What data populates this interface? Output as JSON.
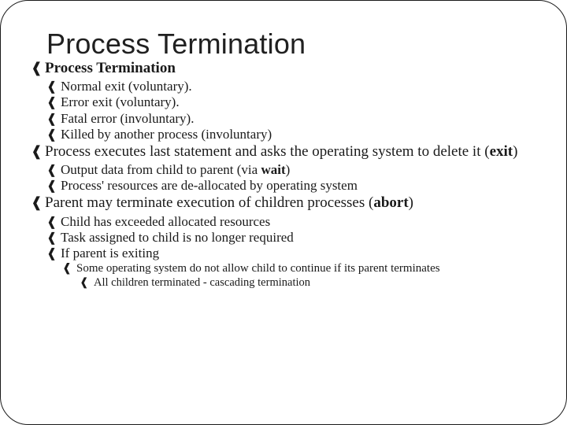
{
  "title": "Process Termination",
  "bullet_glyph": "❰",
  "sections": [
    {
      "head": "Process Termination",
      "sub": [
        "Normal exit (voluntary).",
        "Error exit (voluntary).",
        "Fatal error (involuntary).",
        "Killed by another process (involuntary)"
      ]
    },
    {
      "head_parts": [
        "Process executes last statement and asks the operating system to delete it (",
        "exit",
        ")"
      ],
      "sub": [
        {
          "parts": [
            "Output data from child to parent (via ",
            "wait",
            ")"
          ]
        },
        "Process' resources are de-allocated by operating system"
      ]
    },
    {
      "head_parts": [
        "Parent may terminate execution of children processes (",
        "abort",
        ")"
      ],
      "sub": [
        "Child has exceeded allocated resources",
        "Task assigned to child is no longer required",
        "If parent is exiting"
      ],
      "subsub": [
        "Some operating system do not allow child to continue if its parent terminates"
      ],
      "subsubsub": [
        "All children terminated - cascading termination"
      ]
    }
  ]
}
